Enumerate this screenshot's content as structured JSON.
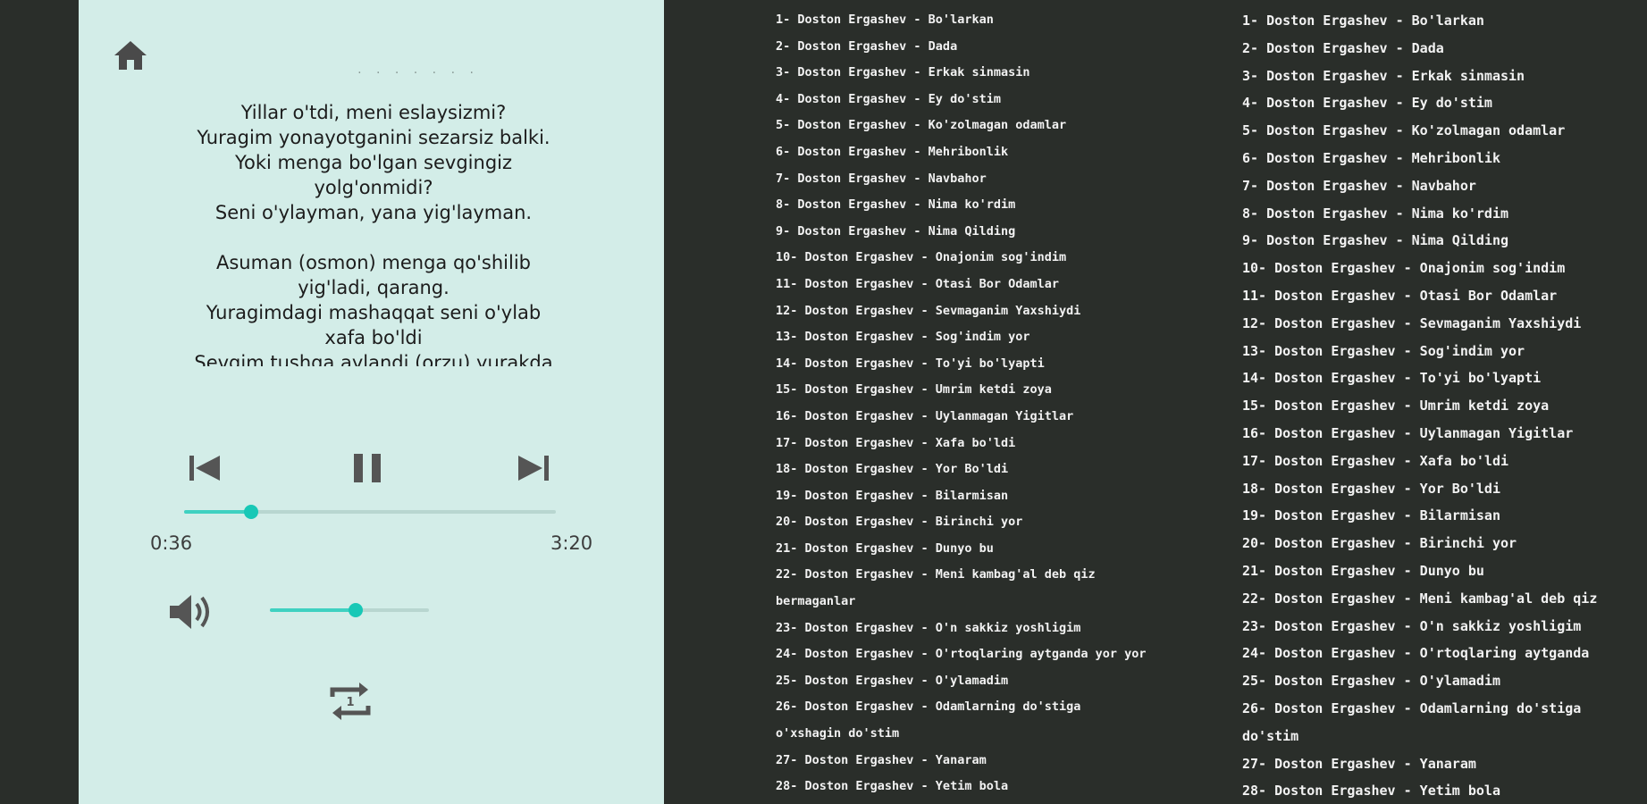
{
  "colors": {
    "player_bg": "#d3ede8",
    "accent": "#18c8b6",
    "terminal_bg": "#2a2e2a",
    "terminal_text": "#f2f2f2"
  },
  "icons": {
    "home": "home-icon",
    "previous": "skip-previous-icon",
    "pause": "pause-icon",
    "next": "skip-next-icon",
    "volume": "volume-up-icon",
    "repeat": "repeat-one-icon"
  },
  "player": {
    "title_placeholder": "· · ·   ·   · · ·",
    "lyrics": [
      [
        "Yillar o'tdi, meni eslaysizmi?",
        "Yuragim yonayotganini sezarsiz balki.",
        "Yoki menga bo'lgan sevgingiz",
        "yolg'onmidi?",
        "Seni o'ylayman, yana yig'layman."
      ],
      [
        "Asuman (osmon) menga qo'shilib",
        "yig'ladi, qarang.",
        "Yuragimdagi mashaqqat seni o'ylab",
        "xafa bo'ldi",
        "Sevgim tushga aylandi (orzu) yurakda"
      ]
    ],
    "elapsed": "0:36",
    "duration": "3:20",
    "progress_fraction": 0.18,
    "volume_fraction": 0.54
  },
  "terminal": {
    "list_a": [
      "1- Doston Ergashev - Bo'larkan",
      "2- Doston Ergashev - Dada",
      "3- Doston Ergashev - Erkak sinmasin",
      "4- Doston Ergashev - Ey do'stim",
      "5- Doston Ergashev - Ko'zolmagan odamlar",
      "6- Doston Ergashev - Mehribonlik",
      "7- Doston Ergashev - Navbahor",
      "8- Doston Ergashev - Nima ko'rdim",
      "9- Doston Ergashev - Nima Qilding",
      "10- Doston Ergashev - Onajonim sog'indim",
      "11- Doston Ergashev - Otasi Bor Odamlar",
      "12- Doston Ergashev - Sevmaganim Yaxshiydi",
      "13- Doston Ergashev - Sog'indim yor",
      "14- Doston Ergashev - To'yi bo'lyapti",
      "15- Doston Ergashev - Umrim ketdi zoya",
      "16- Doston Ergashev - Uylanmagan Yigitlar",
      "17- Doston Ergashev - Xafa bo'ldi",
      "18- Doston Ergashev - Yor Bo'ldi",
      "19- Doston Ergashev - Bilarmisan",
      "20- Doston Ergashev - Birinchi yor",
      "21- Doston Ergashev - Dunyo bu",
      "22- Doston Ergashev - Meni kambag'al deb qiz",
      "bermaganlar",
      "23- Doston Ergashev - O'n sakkiz yoshligim",
      "24- Doston Ergashev - O'rtoqlaring aytganda yor yor",
      "25- Doston Ergashev - O'ylamadim",
      "26- Doston Ergashev - Odamlarning do'stiga",
      "o'xshagin do'stim",
      "27- Doston Ergashev - Yanaram",
      "28- Doston Ergashev - Yetim bola"
    ],
    "list_b": [
      "1- Doston Ergashev - Bo'larkan",
      "2- Doston Ergashev - Dada",
      "3- Doston Ergashev - Erkak sinmasin",
      "4- Doston Ergashev - Ey do'stim",
      "5- Doston Ergashev - Ko'zolmagan odamlar",
      "6- Doston Ergashev - Mehribonlik",
      "7- Doston Ergashev - Navbahor",
      "8- Doston Ergashev - Nima ko'rdim",
      "9- Doston Ergashev - Nima Qilding",
      "10- Doston Ergashev - Onajonim sog'indim",
      "11- Doston Ergashev - Otasi Bor Odamlar",
      "12- Doston Ergashev - Sevmaganim Yaxshiydi",
      "13- Doston Ergashev - Sog'indim yor",
      "14- Doston Ergashev - To'yi bo'lyapti",
      "15- Doston Ergashev - Umrim ketdi zoya",
      "16- Doston Ergashev - Uylanmagan Yigitlar",
      "17- Doston Ergashev - Xafa bo'ldi",
      "18- Doston Ergashev - Yor Bo'ldi",
      "19- Doston Ergashev - Bilarmisan",
      "20- Doston Ergashev - Birinchi yor",
      "21- Doston Ergashev - Dunyo bu",
      "22- Doston Ergashev - Meni kambag'al deb qiz",
      "23- Doston Ergashev - O'n sakkiz yoshligim",
      "24- Doston Ergashev - O'rtoqlaring aytganda",
      "25- Doston Ergashev - O'ylamadim",
      "26- Doston Ergashev - Odamlarning do'stiga",
      "do'stim",
      "27- Doston Ergashev - Yanaram",
      "28- Doston Ergashev - Yetim bola"
    ]
  }
}
